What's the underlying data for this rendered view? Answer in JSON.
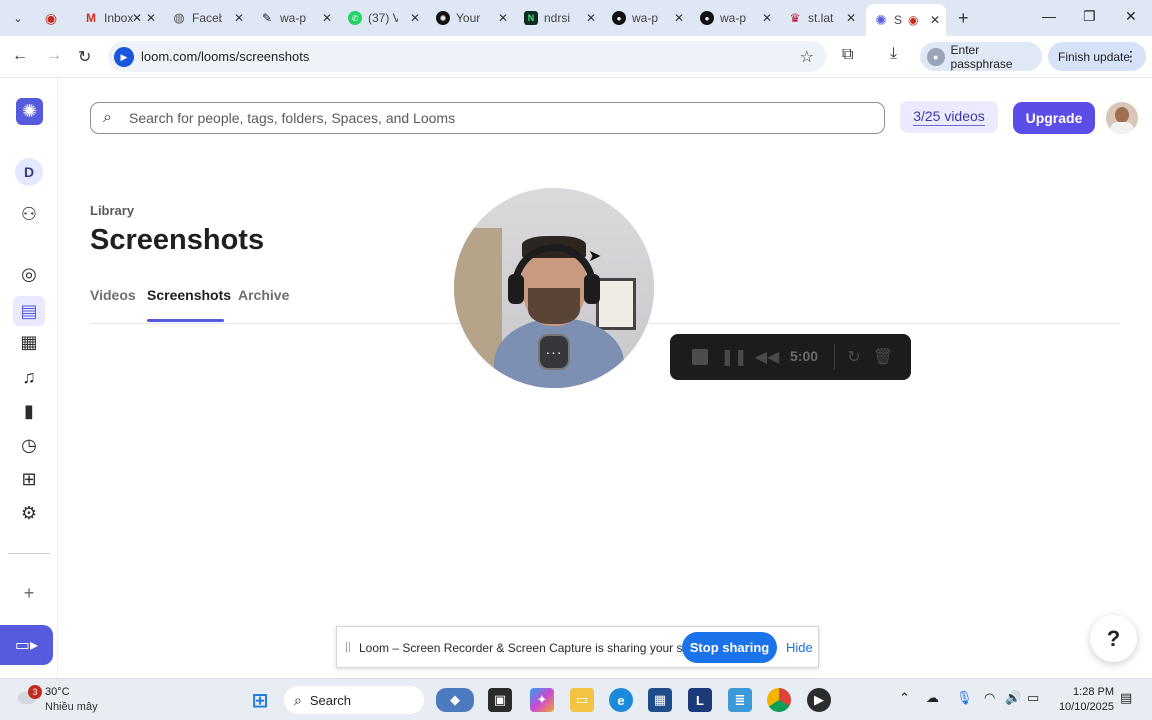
{
  "browser": {
    "tabs": [
      {
        "title": "",
        "favicon": "record-dot"
      },
      {
        "title": "Inbox",
        "favicon": "gmail"
      },
      {
        "title": "Faceb",
        "favicon": "globe"
      },
      {
        "title": "wa-p",
        "favicon": "wa"
      },
      {
        "title": "(37) V",
        "favicon": "whatsapp"
      },
      {
        "title": "Your",
        "favicon": "openai"
      },
      {
        "title": "ndrsi",
        "favicon": "n"
      },
      {
        "title": "wa-p",
        "favicon": "github"
      },
      {
        "title": "wa-p",
        "favicon": "github"
      },
      {
        "title": "st.lat",
        "favicon": "crown"
      },
      {
        "title": "S",
        "favicon": "loom",
        "active": true
      }
    ],
    "url": "loom.com/looms/screenshots",
    "passphrase_label": "Enter passphrase",
    "finish_update_label": "Finish update"
  },
  "header": {
    "search_placeholder": "Search for people, tags, folders, Spaces, and Looms",
    "quota": "3/25 videos",
    "upgrade_label": "Upgrade"
  },
  "sidebar": {
    "workspace_initial": "D"
  },
  "page": {
    "breadcrumb": "Library",
    "title": "Screenshots",
    "tabs": [
      {
        "label": "Videos"
      },
      {
        "label": "Screenshots",
        "active": true
      },
      {
        "label": "Archive"
      }
    ]
  },
  "recorder": {
    "time": "5:00",
    "menu_label": "···"
  },
  "sharing_bar": {
    "message": "Loom – Screen Recorder & Screen Capture is sharing your screen.",
    "stop_label": "Stop sharing",
    "hide_label": "Hide"
  },
  "help_label": "?",
  "taskbar": {
    "weather_badge": "3",
    "temperature": "30°C",
    "condition": "Nhiều mây",
    "search_label": "Search",
    "time": "1:28 PM",
    "date": "10/10/2025"
  },
  "colors": {
    "accent": "#565add",
    "upgrade": "#5b4de6",
    "share_blue": "#1a73e8"
  }
}
